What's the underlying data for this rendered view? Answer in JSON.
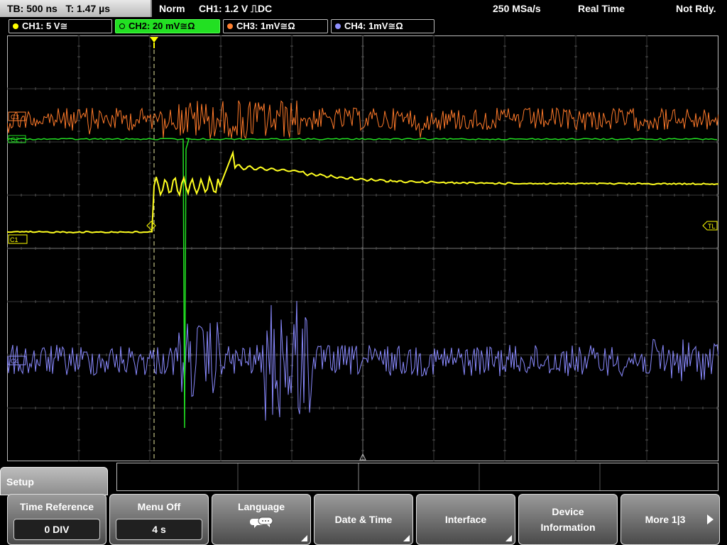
{
  "topbar": {
    "timebase": "TB: 500 ns",
    "trigger_pos": "T: 1.47 µs",
    "mode": "Norm",
    "trigger_info": "CH1: 1.2 V ⎍DC",
    "sample_rate": "250 MSa/s",
    "acquisition": "Real Time",
    "status": "Not Rdy."
  },
  "channels": [
    {
      "label": "CH1: 5 V≅",
      "color": "#ffff00"
    },
    {
      "label": "CH2: 20 mV≅Ω",
      "color": "#22e022"
    },
    {
      "label": "CH3: 1mV≅Ω",
      "color": "#ff8030"
    },
    {
      "label": "CH4: 1mV≅Ω",
      "color": "#9090ff"
    }
  ],
  "markers": {
    "ch1": "C1",
    "ch2": "C2",
    "ch3": "C3",
    "ch4": "C4",
    "trigger_level": "TL",
    "trigger_time": "T"
  },
  "menu": {
    "title": "Setup",
    "softkeys": [
      {
        "label": "Time Reference",
        "value": "0 DIV"
      },
      {
        "label": "Menu Off",
        "value": "4 s"
      },
      {
        "label": "Language",
        "icon": "speech-bubble-icon"
      },
      {
        "label": "Date & Time"
      },
      {
        "label": "Interface"
      },
      {
        "label": "Device Information",
        "line1": "Device",
        "line2": "Information"
      },
      {
        "label": "More 1|3"
      }
    ]
  }
}
